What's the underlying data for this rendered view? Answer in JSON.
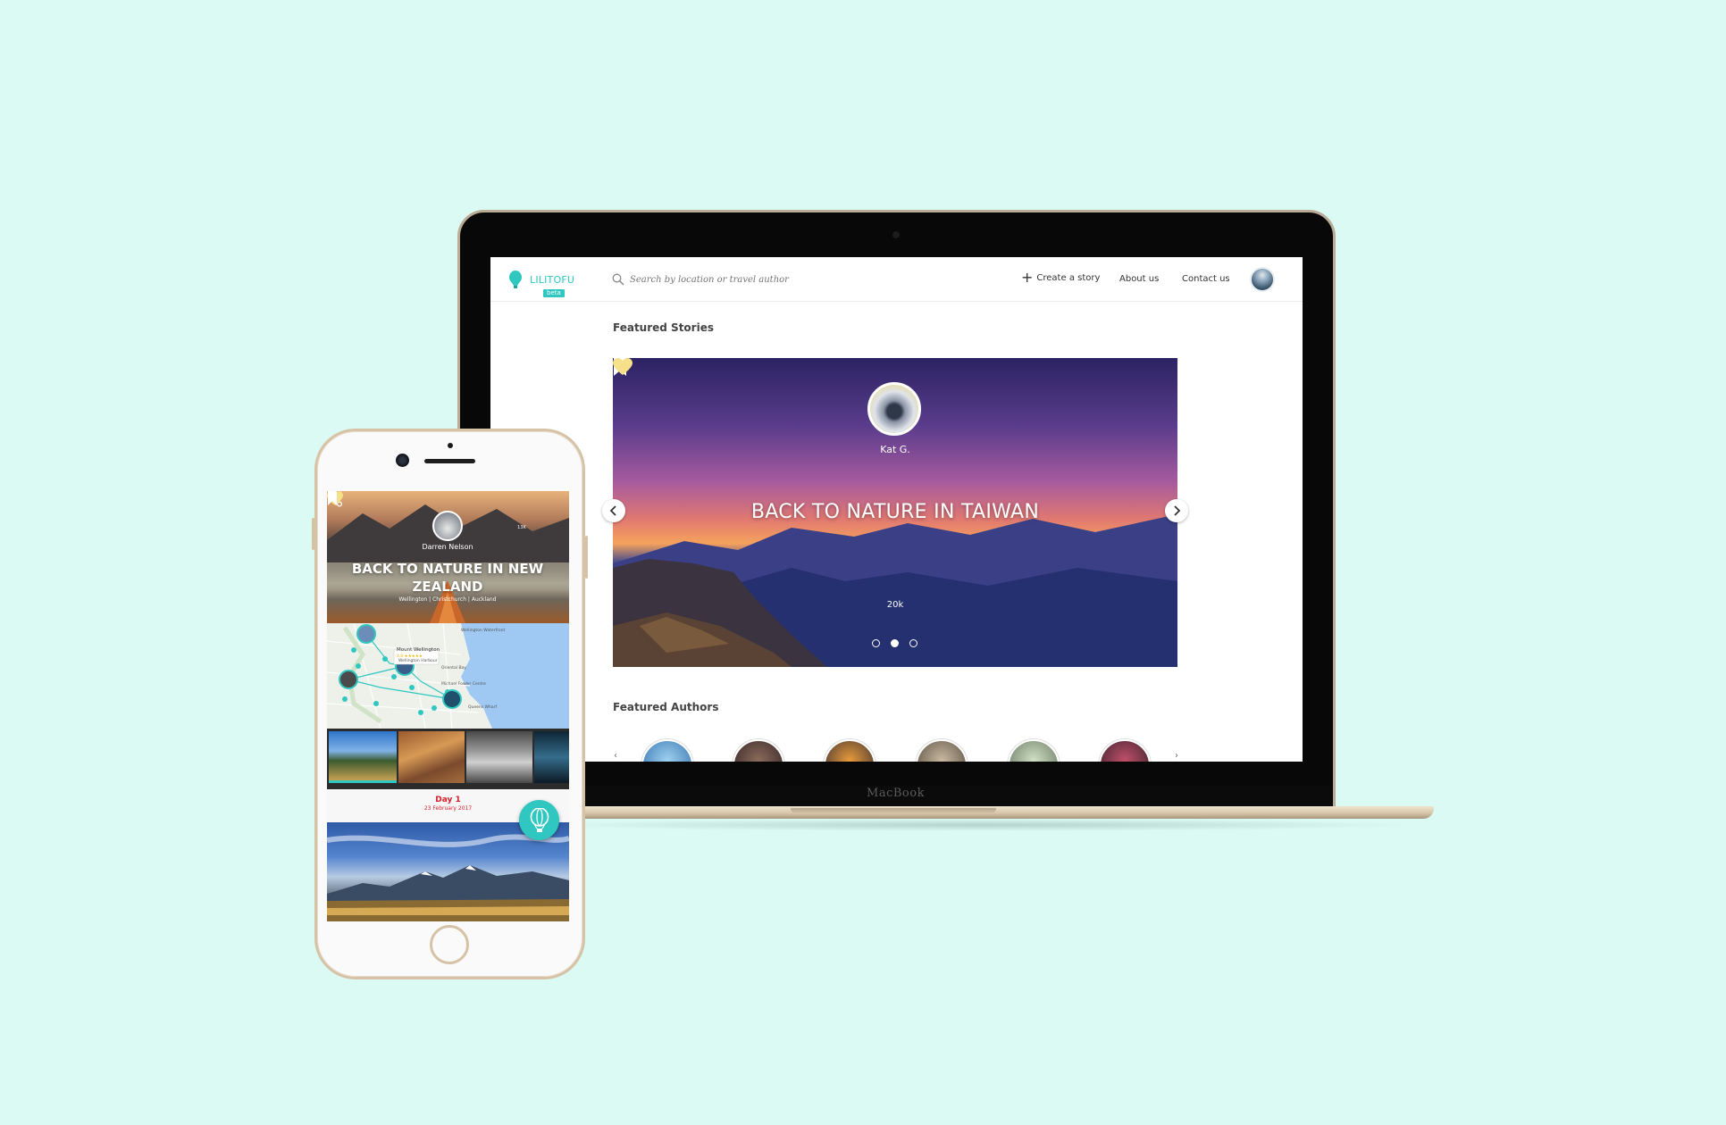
{
  "laptop": {
    "brand_label": "MacBook",
    "site": {
      "logo_text": "LILITOFU",
      "beta_label": "beta",
      "search_placeholder": "Search by location or travel author",
      "nav": {
        "create_story": "Create a story",
        "about": "About us",
        "contact": "Contact us"
      },
      "featured_stories": {
        "heading": "Featured Stories",
        "current_story": {
          "author": "Kat G.",
          "title": "BACK TO NATURE IN TAIWAN",
          "likes": "20k"
        },
        "carousel_slides": 3,
        "active_slide": 2
      },
      "featured_authors": {
        "heading": "Featured Authors",
        "count_visible": 6
      }
    }
  },
  "phone": {
    "story": {
      "author": "Darren Nelson",
      "title": "BACK TO NATURE IN NEW ZEALAND",
      "route": "Wellington  |  Christchurch  |  Auckland",
      "likes": "13K"
    },
    "map": {
      "place_name": "Mount Wellington",
      "rating": "4.8 ★★★★★",
      "labels": {
        "waterfront": "Wellington Waterfront",
        "wharf_district": "Wellington Harbour",
        "oriental": "Oriental Bay",
        "fowler": "Michael Fowler Centre",
        "wharf": "Queens Wharf"
      }
    },
    "day": {
      "label": "Day 1",
      "date": "23 February 2017"
    }
  },
  "colors": {
    "background": "#dbfaf4",
    "brand_teal": "#2fc7c0",
    "day_red": "#d41f2b",
    "heart_yellow": "#f7e08a"
  }
}
